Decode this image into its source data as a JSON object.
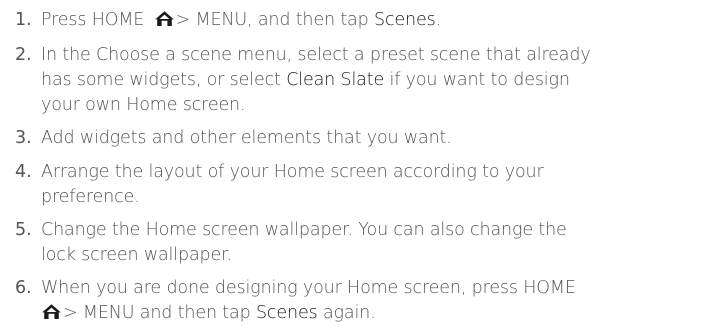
{
  "steps": [
    {
      "number": "1.",
      "lines": [
        {
          "a": "Press HOME ",
          "icon": "home-icon",
          "b": "> MENU, and then tap ",
          "em": "Scenes",
          "c": "."
        }
      ]
    },
    {
      "number": "2.",
      "lines": [
        {
          "a": "In the Choose a scene menu, select a preset scene that already"
        },
        {
          "a": "has some widgets, or select ",
          "em": "Clean Slate",
          "c": " if you want to design"
        },
        {
          "a": "your own Home screen."
        }
      ]
    },
    {
      "number": "3.",
      "lines": [
        {
          "a": "Add widgets and other elements that you want."
        }
      ]
    },
    {
      "number": "4.",
      "lines": [
        {
          "a": "Arrange the layout of your Home screen according to your"
        },
        {
          "a": "preference."
        }
      ]
    },
    {
      "number": "5.",
      "lines": [
        {
          "a": "Change the Home screen wallpaper. You can also change the"
        },
        {
          "a": "lock screen wallpaper."
        }
      ]
    },
    {
      "number": "6.",
      "lines": [
        {
          "a": "When you are done designing your Home screen, press HOME"
        },
        {
          "icon": "home-icon",
          "b": "> MENU and then tap ",
          "em": "Scenes",
          "c": " again."
        }
      ]
    }
  ],
  "colors": {
    "text": "#555555",
    "emphasis": "#1a1a1a",
    "icon": "#1a1a1a"
  }
}
